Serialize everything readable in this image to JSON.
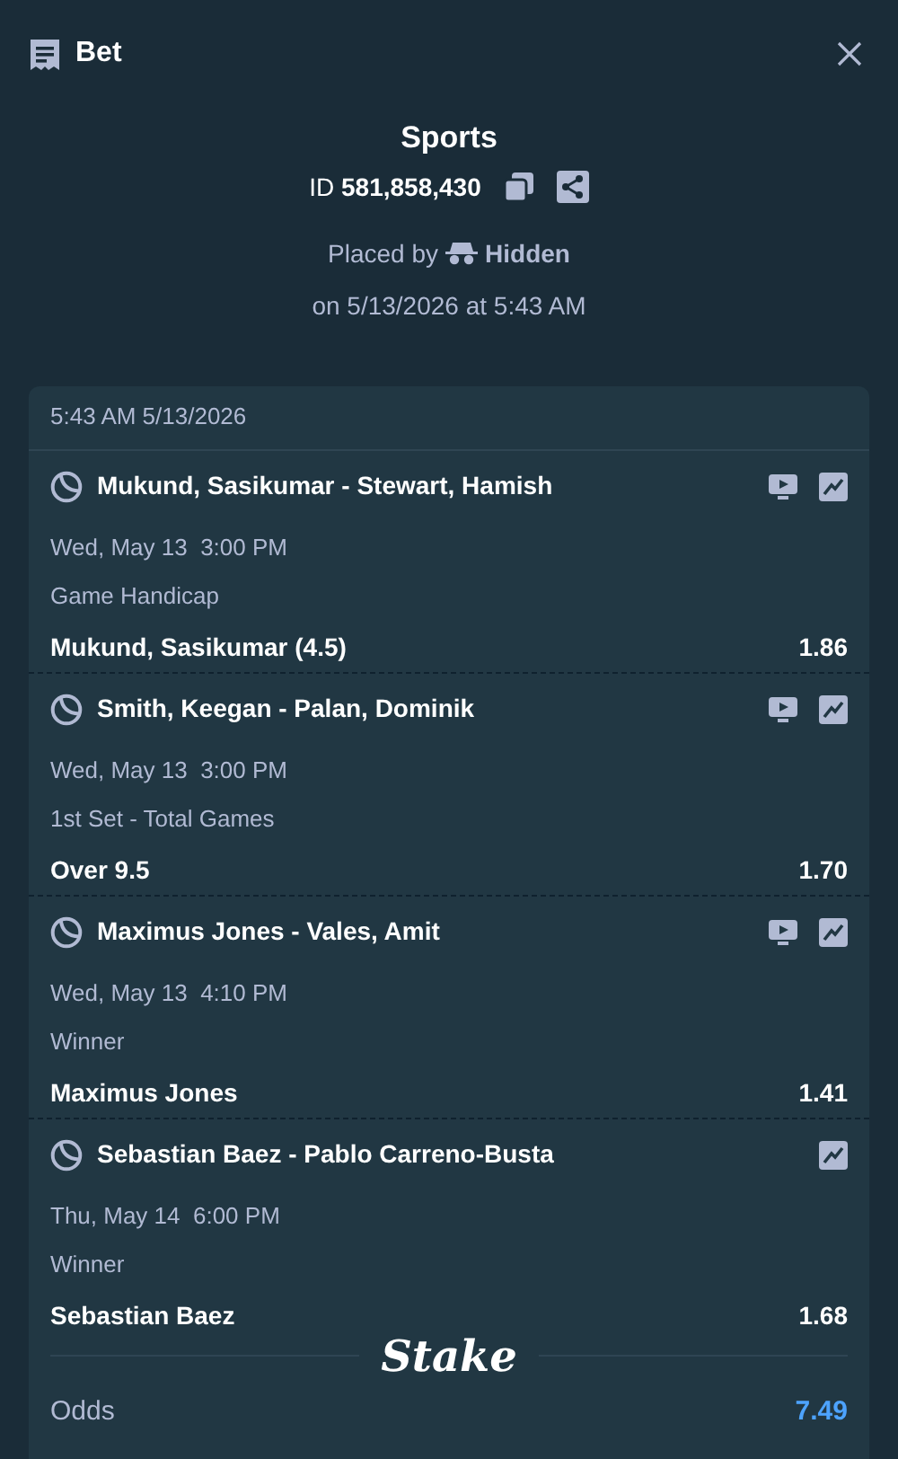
{
  "header": {
    "title": "Bet"
  },
  "summary": {
    "title": "Sports",
    "id_label": "ID",
    "id": "581,858,430",
    "placed_by": "Placed by",
    "user": "Hidden",
    "placed_on": "on 5/13/2026 at 5:43 AM"
  },
  "slip": {
    "timestamp": "5:43 AM 5/13/2026",
    "legs": [
      {
        "event": "Mukund, Sasikumar - Stewart, Hamish",
        "stream": true,
        "time": "Wed, May 13  3:00 PM",
        "market": "Game Handicap",
        "selection": "Mukund, Sasikumar (4.5)",
        "odds": "1.86"
      },
      {
        "event": "Smith, Keegan - Palan, Dominik",
        "stream": true,
        "time": "Wed, May 13  3:00 PM",
        "market": "1st Set - Total Games",
        "selection": "Over 9.5",
        "odds": "1.70"
      },
      {
        "event": "Maximus Jones - Vales, Amit",
        "stream": true,
        "time": "Wed, May 13  4:10 PM",
        "market": "Winner",
        "selection": "Maximus Jones",
        "odds": "1.41"
      },
      {
        "event": "Sebastian Baez - Pablo Carreno-Busta",
        "stream": false,
        "time": "Thu, May 14  6:00 PM",
        "market": "Winner",
        "selection": "Sebastian Baez",
        "odds": "1.68"
      }
    ],
    "brand": "Stake",
    "odds_label": "Odds",
    "total_odds": "7.49"
  }
}
